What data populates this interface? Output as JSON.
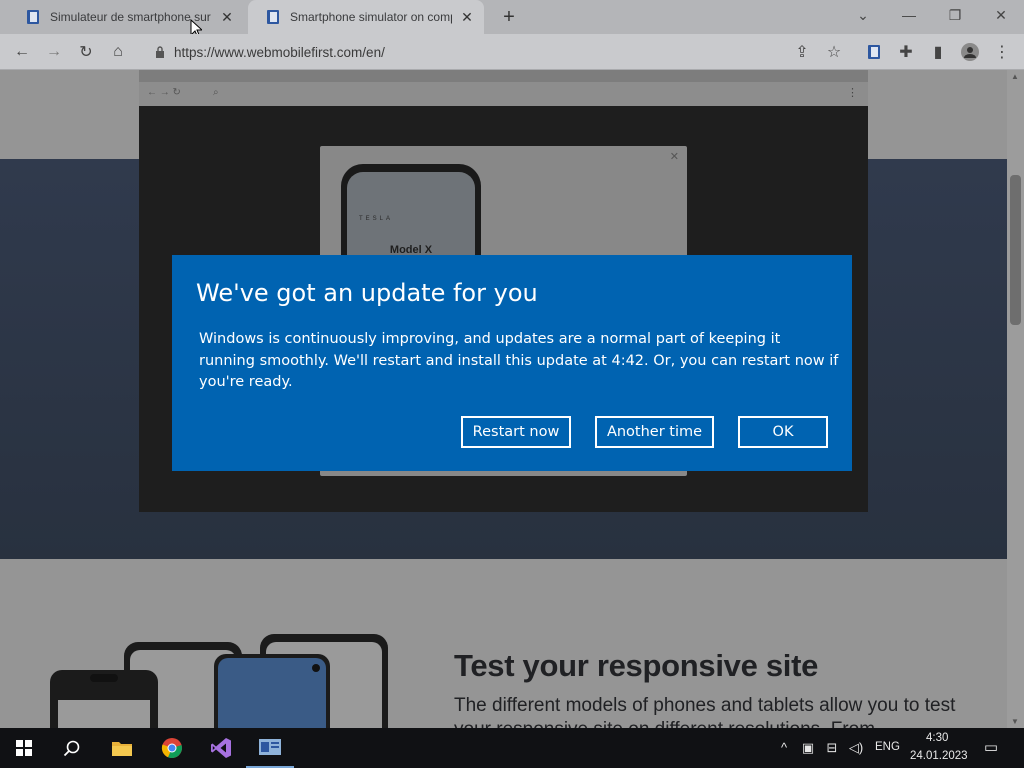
{
  "browser": {
    "tabs": [
      {
        "title": "Simulateur de smartphone sur ordinateur",
        "active": false
      },
      {
        "title": "Smartphone simulator on computer",
        "active": true
      }
    ],
    "url": "https://www.webmobilefirst.com/en/"
  },
  "page": {
    "phone_brand": "TESLA",
    "phone_model": "Model X",
    "section_title": "Test your responsive site",
    "section_text": "The different models of phones and tablets allow you to test your responsive site on different resolutions. From"
  },
  "dialog": {
    "title": "We've got an update for you",
    "message": "Windows is continuously improving, and updates are a normal part of keeping it running smoothly. We'll restart and install this update at 4:42. Or, you can restart now if you're ready.",
    "buttons": {
      "restart_now": "Restart now",
      "another_time": "Another time",
      "ok": "OK"
    },
    "color": "#0063b1"
  },
  "taskbar": {
    "language": "ENG",
    "time": "4:30",
    "date": "24.01.2023"
  }
}
